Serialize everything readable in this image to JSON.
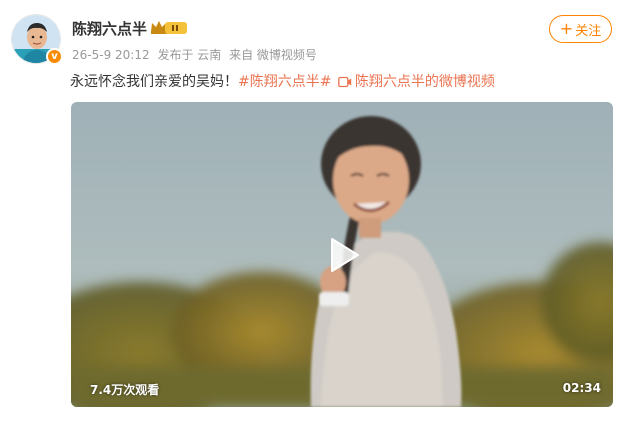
{
  "user": {
    "name": "陈翔六点半",
    "verified_mark": "v"
  },
  "post": {
    "date": "26-5-9 20:12",
    "published_from": "发布于 云南",
    "source": "来自 微博视频号",
    "text": "永远怀念我们亲爱的吴妈！",
    "hashtag": "#陈翔六点半#",
    "video_link": "陈翔六点半的微博视频"
  },
  "actions": {
    "follow_label": "关注"
  },
  "video": {
    "views": "7.4万次观看",
    "duration": "02:34"
  },
  "colors": {
    "accent": "#ff8200",
    "link": "#eb7350",
    "meta": "#999999",
    "verified": "#f78b05"
  },
  "icons": [
    "verified-icon",
    "crown-icon",
    "plus-icon",
    "video-link-icon",
    "play-icon"
  ]
}
